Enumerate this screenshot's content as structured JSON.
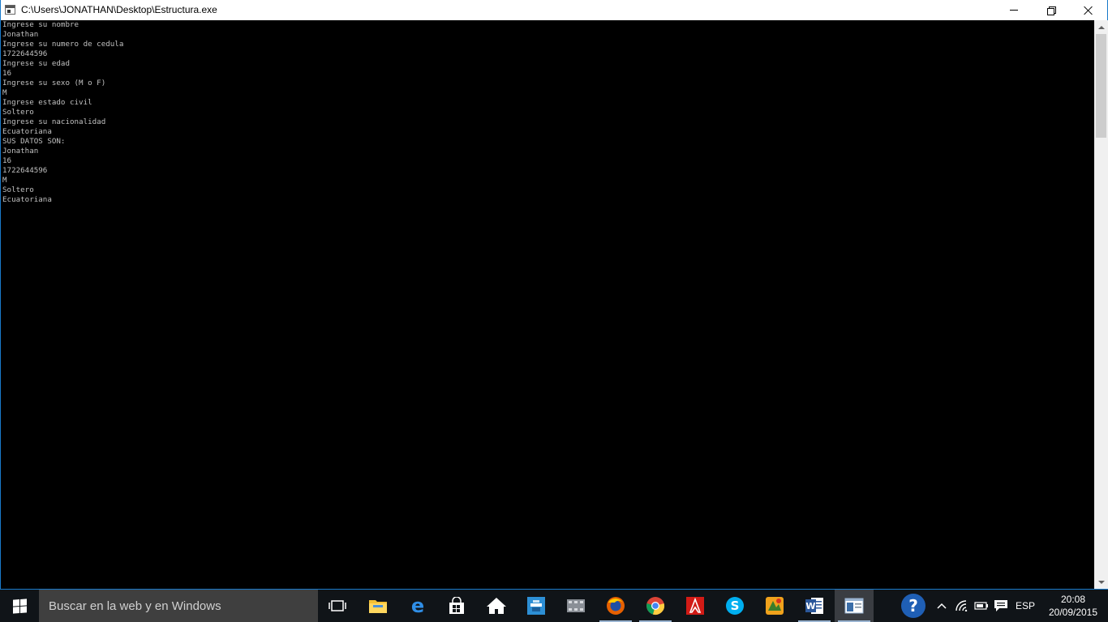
{
  "window": {
    "title": "C:\\Users\\JONATHAN\\Desktop\\Estructura.exe",
    "controls": {
      "minimize": "minimize",
      "restore": "restore",
      "close": "close"
    }
  },
  "console": {
    "lines": [
      "Ingrese su nombre",
      "Jonathan",
      "Ingrese su numero de cedula",
      "1722644596",
      "Ingrese su edad",
      "16",
      "Ingrese su sexo (M o F)",
      "M",
      "Ingrese estado civil",
      "Soltero",
      "Ingrese su nacionalidad",
      "Ecuatoriana",
      "SUS DATOS SON:",
      "Jonathan",
      "16",
      "1722644596",
      "M",
      "Soltero",
      "Ecuatoriana"
    ]
  },
  "taskbar": {
    "search_placeholder": "Buscar en la web y en Windows",
    "apps": [
      "task-view",
      "file-explorer",
      "edge",
      "store",
      "home",
      "app-blue",
      "app-film",
      "firefox",
      "chrome",
      "adobe-reader",
      "skype",
      "app-game",
      "word",
      "console-window"
    ],
    "tray": {
      "language": "ESP",
      "time": "20:08",
      "date": "20/09/2015"
    }
  },
  "colors": {
    "console_bg": "#000000",
    "console_text": "#c0c0c0",
    "window_border": "#1979ca",
    "taskbar_bg": "#101418",
    "search_bg": "#3f3f3f"
  }
}
